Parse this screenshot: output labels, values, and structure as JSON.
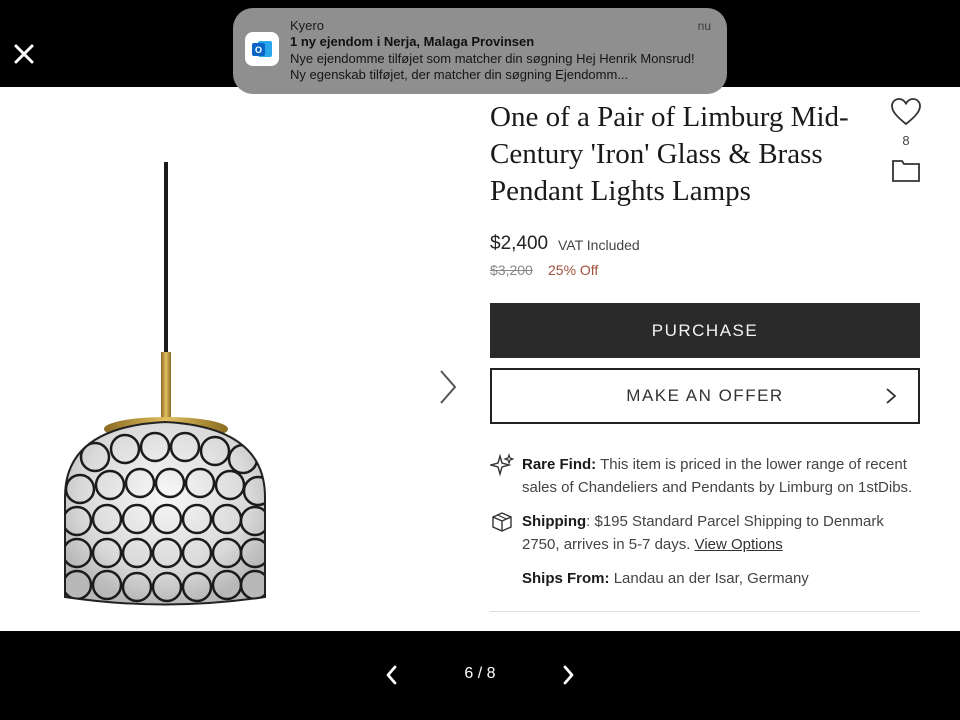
{
  "viewer": {
    "close_icon": "close-icon",
    "counter": "6 / 8",
    "prev_icon": "chevron-left-icon",
    "next_icon": "chevron-right-icon"
  },
  "notification": {
    "app": "Kyero",
    "time": "nu",
    "title": "1 ny ejendom i Nerja, Malaga Provinsen",
    "body": "Nye ejendomme tilføjet som matcher din søgning Hej Henrik Monsrud! Ny egenskab tilføjet, der matcher din søgning Ejendomm...",
    "icon": "outlook-icon"
  },
  "product": {
    "title": "One of a Pair of Limburg Mid-Century 'Iron' Glass & Brass Pendant Lights Lamps",
    "favorites_count": "8",
    "price": "$2,400",
    "vat": "VAT Included",
    "old_price": "$3,200",
    "discount": "25% Off",
    "purchase_label": "PURCHASE",
    "offer_label": "MAKE AN OFFER"
  },
  "info": {
    "rare_find_label": "Rare Find:",
    "rare_find_text": "This item is priced in the lower range of recent sales of Chandeliers and Pendants by Limburg on 1stDibs.",
    "shipping_label": "Shipping",
    "shipping_text": ": $195 Standard Parcel Shipping to Denmark 2750, arrives in 5-7 days.",
    "shipping_link": "View Options",
    "ships_from_label": "Ships From:",
    "ships_from_text": "Landau an der Isar, Germany"
  },
  "colors": {
    "bar_bg": "#000000",
    "purchase_bg": "#2a2a2a",
    "discount": "#a0523d",
    "notification_bg": "#8f8f8f"
  }
}
